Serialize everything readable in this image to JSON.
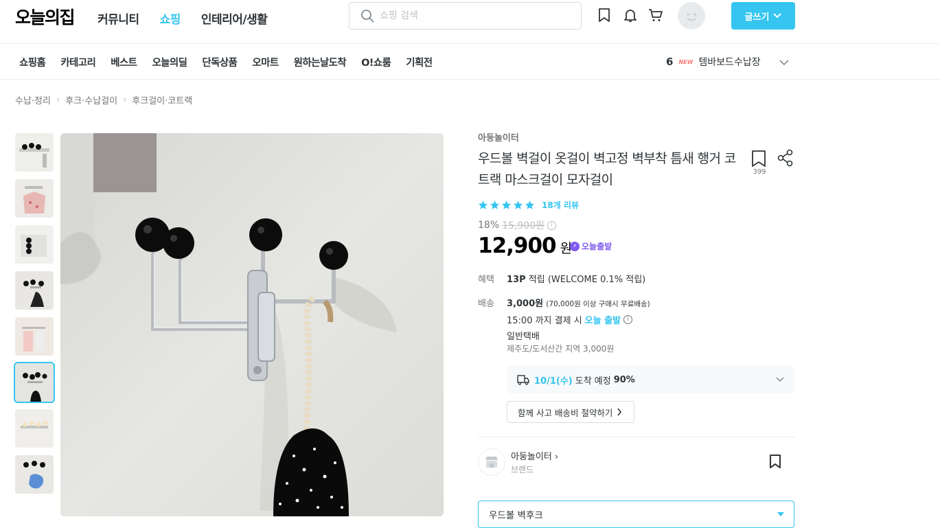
{
  "header": {
    "logo": "오늘의집",
    "nav": [
      "커뮤니티",
      "쇼핑",
      "인테리어/생활"
    ],
    "active_nav": "쇼핑",
    "search_placeholder": "쇼핑 검색",
    "write_button": "글쓰기"
  },
  "subnav": {
    "items": [
      "쇼핑홈",
      "카테고리",
      "베스트",
      "오늘의딜",
      "단독상품",
      "오마트",
      "원하는날도착",
      "O!쇼룸",
      "기획전"
    ],
    "rank_number": "6",
    "rank_badge": "NEW",
    "rank_keyword": "템바보드수납장"
  },
  "breadcrumb": [
    "수납·정리",
    "후크·수납걸이",
    "후크걸이·코트랙"
  ],
  "thumbnails": {
    "count": 8,
    "selected_index": 5
  },
  "product": {
    "brand": "아둥놀이터",
    "title": "우드볼 벽걸이 옷걸이 벽고정 벽부착 틈새 행거 코트랙 마스크걸이 모자걸이",
    "bookmark_count": "399",
    "rating_stars": 5,
    "review_label": "18개 리뷰",
    "discount": "18%",
    "original_price": "15,900원",
    "price": "12,900",
    "price_unit": "원",
    "delivery_badge": "오늘출발",
    "benefit_label": "혜택",
    "benefit_points": "13P",
    "benefit_text": "적립 (WELCOME 0.1% 적립)",
    "shipping_label": "배송",
    "shipping_fee": "3,000원",
    "shipping_note": "(70,000원 이상 구매시 무료배송)",
    "cutoff_prefix": "15:00 까지 결제 시",
    "cutoff_highlight": "오늘 출발",
    "shipping_type": "일반택배",
    "island_note": "제주도/도서산간 지역 3,000원",
    "arrival_date": "10/1(수)",
    "arrival_text": "도착 예정",
    "arrival_rate": "90%",
    "bundle_button": "함께 사고 배송비 절약하기",
    "store_name": "아둥놀이터",
    "store_type": "브랜드",
    "option_selected": "우드볼 벽후크"
  },
  "colors": {
    "accent": "#35c5f0",
    "text": "#2f3438",
    "sub_text": "#757575",
    "badge_purple": "#7f5af0",
    "new_red": "#ff7777"
  }
}
